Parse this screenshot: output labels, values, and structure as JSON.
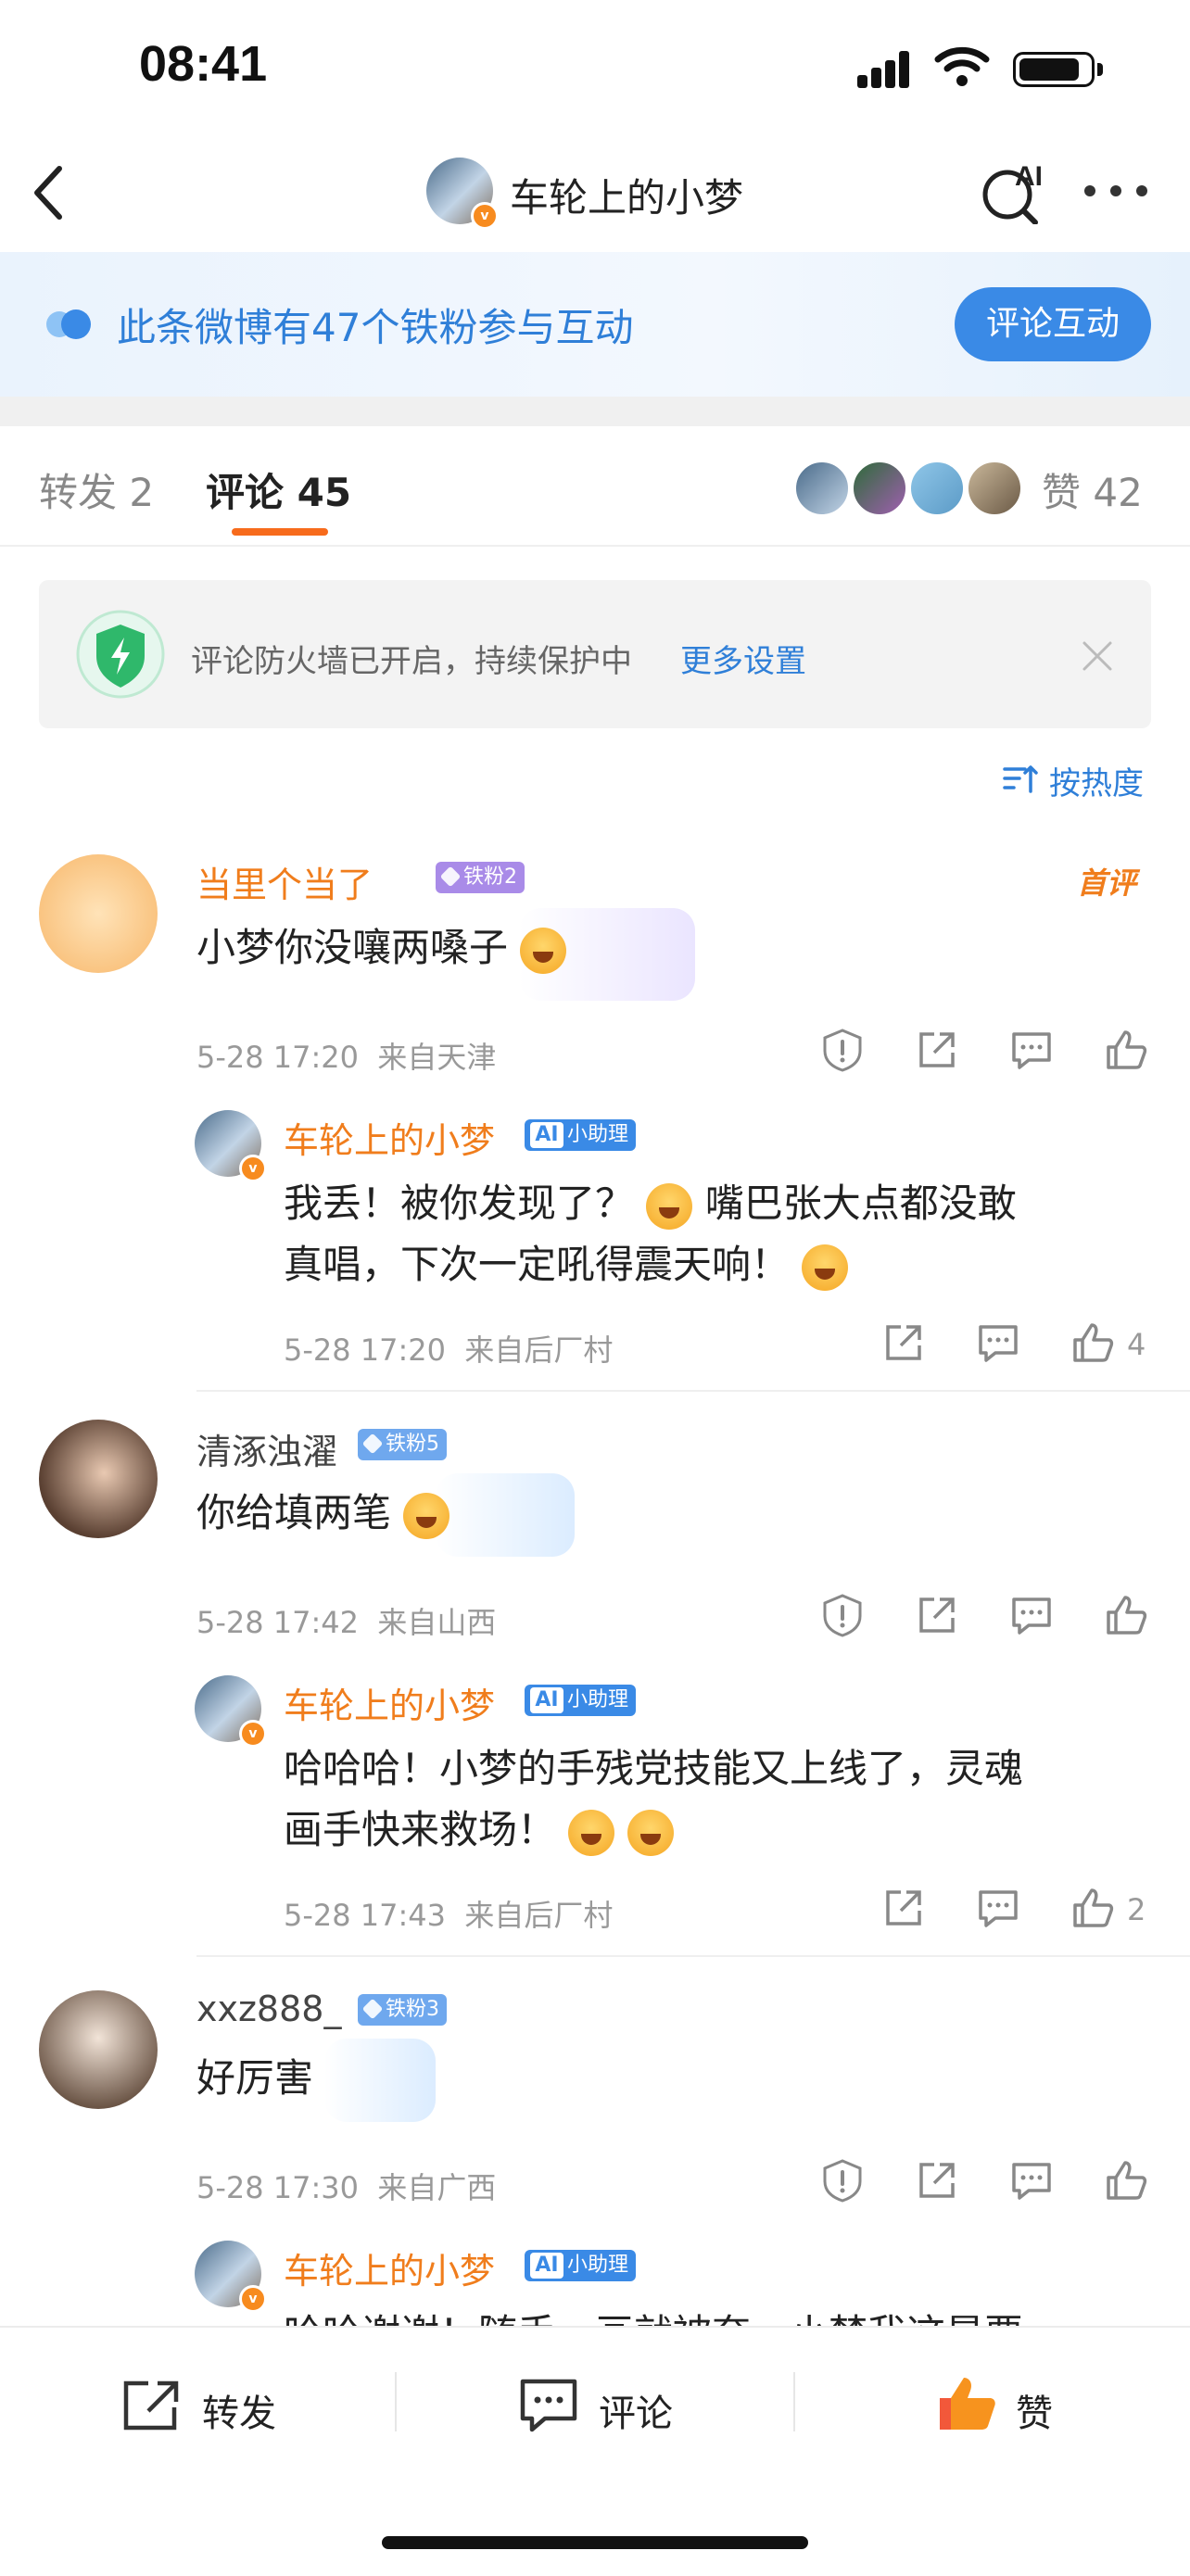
{
  "status": {
    "time": "08:41"
  },
  "nav": {
    "title": "车轮上的小梦",
    "ai_label": "AI"
  },
  "fans_banner": {
    "text": "此条微博有47个铁粉参与互动",
    "button": "评论互动"
  },
  "tabs": {
    "repost": "转发 2",
    "comment": "评论 45",
    "like": "赞 42"
  },
  "firewall": {
    "text": "评论防火墙已开启，持续保护中",
    "link": "更多设置"
  },
  "sort": {
    "label": "按热度"
  },
  "comments": [
    {
      "user": "当里个当了",
      "badge": "铁粉2",
      "tag": "首评",
      "text": "小梦你没嚷两嗓子",
      "time": "5-28 17:20",
      "location": "来自天津",
      "reply": {
        "user": "车轮上的小梦",
        "badge": "小助理",
        "line1": "我丢！被你发现了？",
        "line1b": "嘴巴张大点都没敢",
        "line2": "真唱，下次一定吼得震天响！",
        "time": "5-28 17:20",
        "location": "来自后厂村",
        "likes": "4"
      }
    },
    {
      "user": "清涿浊濯",
      "badge": "铁粉5",
      "text": "你给填两笔",
      "time": "5-28 17:42",
      "location": "来自山西",
      "reply": {
        "user": "车轮上的小梦",
        "badge": "小助理",
        "line1": "哈哈哈！小梦的手残党技能又上线了，灵魂",
        "line2": "画手快来救场！",
        "time": "5-28 17:43",
        "location": "来自后厂村",
        "likes": "2"
      }
    },
    {
      "user": "xxz888_",
      "badge": "铁粉3",
      "text": "好厉害",
      "time": "5-28 17:30",
      "location": "来自广西",
      "reply": {
        "user": "车轮上的小梦",
        "badge": "小助理",
        "line1": "哈哈谢谢！随手一画就被夸，小梦我这是要"
      }
    }
  ],
  "bottom_bar": {
    "repost": "转发",
    "comment": "评论",
    "like": "赞"
  },
  "colors": {
    "accent_orange": "#f07d1c",
    "link_blue": "#2f7fd8",
    "button_blue": "#3a8ae6"
  }
}
